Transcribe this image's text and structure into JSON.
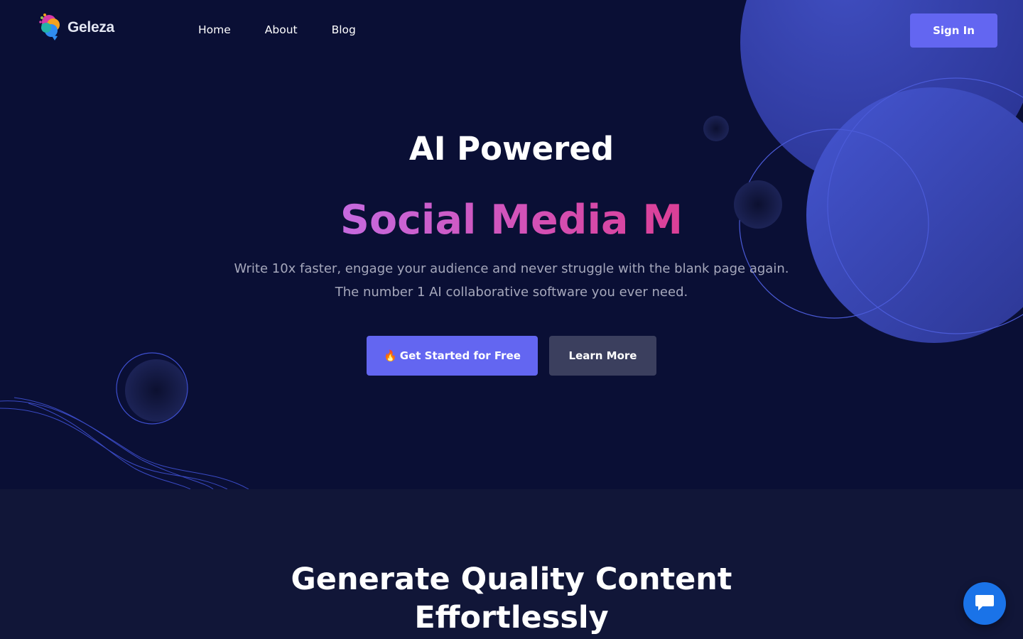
{
  "header": {
    "logo_text": "Geleza",
    "nav": [
      {
        "label": "Home"
      },
      {
        "label": "About"
      },
      {
        "label": "Blog"
      }
    ],
    "signin_label": "Sign In"
  },
  "hero": {
    "title_line1": "AI Powered",
    "title_line2": "Social Media M",
    "subtitle_line1": "Write 10x faster, engage your audience and never struggle with the blank page again.",
    "subtitle_line2": "The number 1 AI collaborative software you ever need.",
    "primary_button": {
      "emoji": "🔥",
      "label": "Get Started for Free"
    },
    "secondary_button": {
      "label": "Learn More"
    }
  },
  "section2": {
    "title_line1": "Generate Quality Content",
    "title_line2": "Effortlessly"
  },
  "chat": {
    "icon": "chat-bubble-icon"
  },
  "colors": {
    "background": "#0a0f35",
    "accent": "#6366f1",
    "secondary_button": "#3b3f5e",
    "gradient_start": "#c56adf",
    "gradient_end": "#db3f96",
    "chat": "#1a73e8"
  }
}
